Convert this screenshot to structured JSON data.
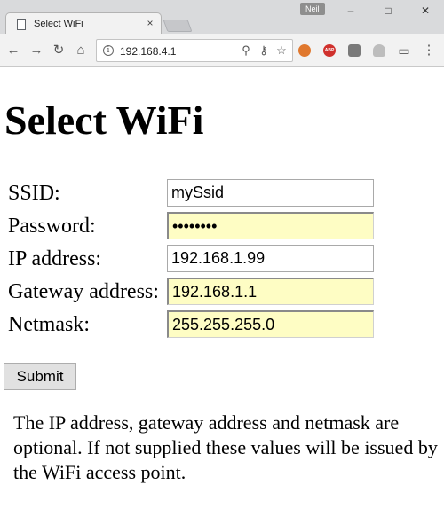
{
  "browser": {
    "tab_title": "Select WiFi",
    "tab_close_glyph": "×",
    "profile_name": "Neil",
    "url": "192.168.4.1",
    "window_controls": {
      "minimize": "–",
      "maximize": "□",
      "close": "✕"
    },
    "nav_glyphs": {
      "back": "←",
      "forward": "→",
      "reload": "↻",
      "home": "⌂"
    },
    "omnibox_icons": [
      "zoom-icon",
      "key-icon",
      "bookmark-star-icon"
    ],
    "omnibox_glyphs": {
      "zoom": "⚲",
      "key": "⚷",
      "star": "☆"
    },
    "extension_icons": [
      "cookie-extension-icon",
      "adblock-plus-icon",
      "extension-icon",
      "cloud-extension-icon",
      "cast-icon",
      "menu-icon"
    ],
    "abp_text": "ABP",
    "menu_glyph": "⋮",
    "cast_glyph": "▭"
  },
  "page": {
    "title": "Select WiFi",
    "form": {
      "fields": [
        {
          "label": "SSID:",
          "value": "mySsid",
          "type": "text",
          "autofill": false
        },
        {
          "label": "Password:",
          "value": "passwd12",
          "type": "password",
          "autofill": true
        },
        {
          "label": "IP address:",
          "value": "192.168.1.99",
          "type": "text",
          "autofill": false
        },
        {
          "label": "Gateway address:",
          "value": "192.168.1.1",
          "type": "text",
          "autofill": true
        },
        {
          "label": "Netmask:",
          "value": "255.255.255.0",
          "type": "text",
          "autofill": true
        }
      ],
      "submit_label": "Submit"
    },
    "note": "The IP address, gateway address and netmask are optional. If not supplied these values will be issued by the WiFi access point."
  },
  "colors": {
    "autofill_background": "#fefdc4",
    "chrome_titlebar": "#d9dadc",
    "chrome_toolbar": "#f2f2f2"
  }
}
